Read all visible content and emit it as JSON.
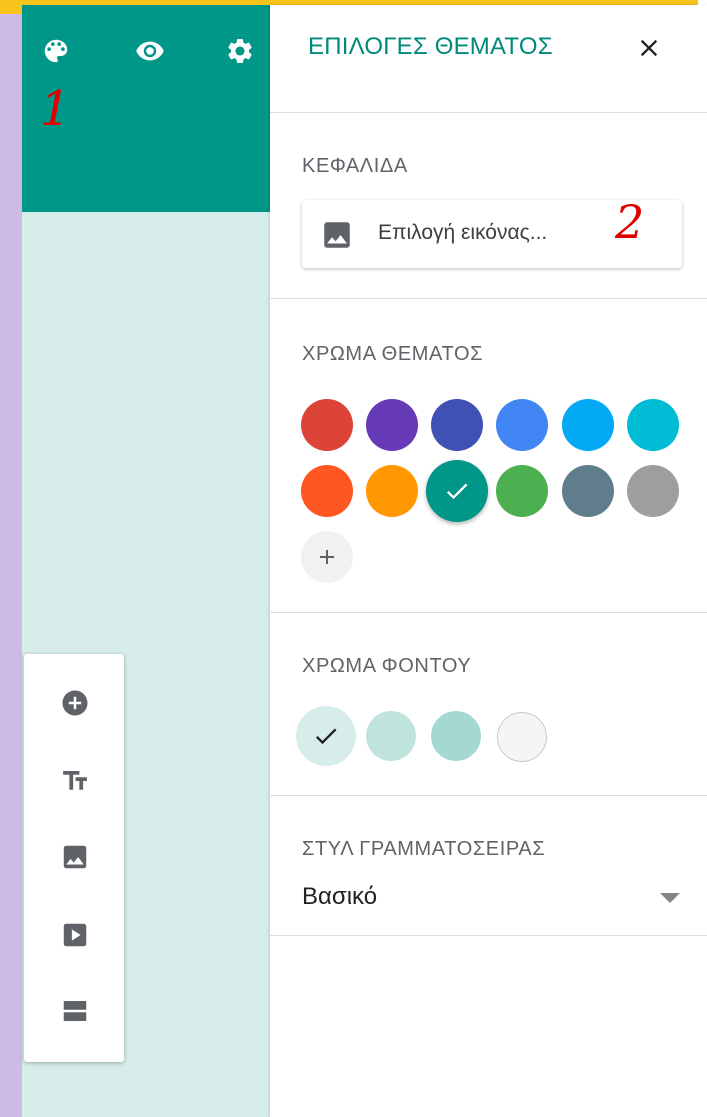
{
  "header": {
    "color": "#009688",
    "icons": [
      "palette-icon",
      "eye-icon",
      "settings-icon"
    ],
    "annotation_1": "1"
  },
  "side_toolbar": {
    "icons": [
      "add-circle-icon",
      "text-format-icon",
      "image-icon",
      "video-icon",
      "section-icon"
    ]
  },
  "panel": {
    "title": "ΕΠΙΛΟΓΕΣ ΘΕΜΑΤΟΣ",
    "header_section": {
      "label": "ΚΕΦΑΛΙΔΑ",
      "choose_image_label": "Επιλογή εικόνας...",
      "annotation_2": "2"
    },
    "theme_color": {
      "label": "ΧΡΩΜΑ ΘΕΜΑΤΟΣ",
      "colors": [
        "#db4437",
        "#673ab7",
        "#3f51b5",
        "#4285f4",
        "#03a9f4",
        "#00bcd4",
        "#ff5722",
        "#ff9800",
        "#009688",
        "#4caf50",
        "#607d8b",
        "#9e9e9e"
      ],
      "selected": "#009688"
    },
    "background_color": {
      "label": "ΧΡΩΜΑ ΦΟΝΤΟΥ",
      "colors": [
        "#d7ede9",
        "#bfe3dd",
        "#a4d9d2",
        "#f5f5f5"
      ],
      "selected": "#d7ede9"
    },
    "font_style": {
      "label": "ΣΤΥΛ ΓΡΑΜΜΑΤΟΣΕΙΡΑΣ",
      "value": "Βασικό"
    }
  }
}
